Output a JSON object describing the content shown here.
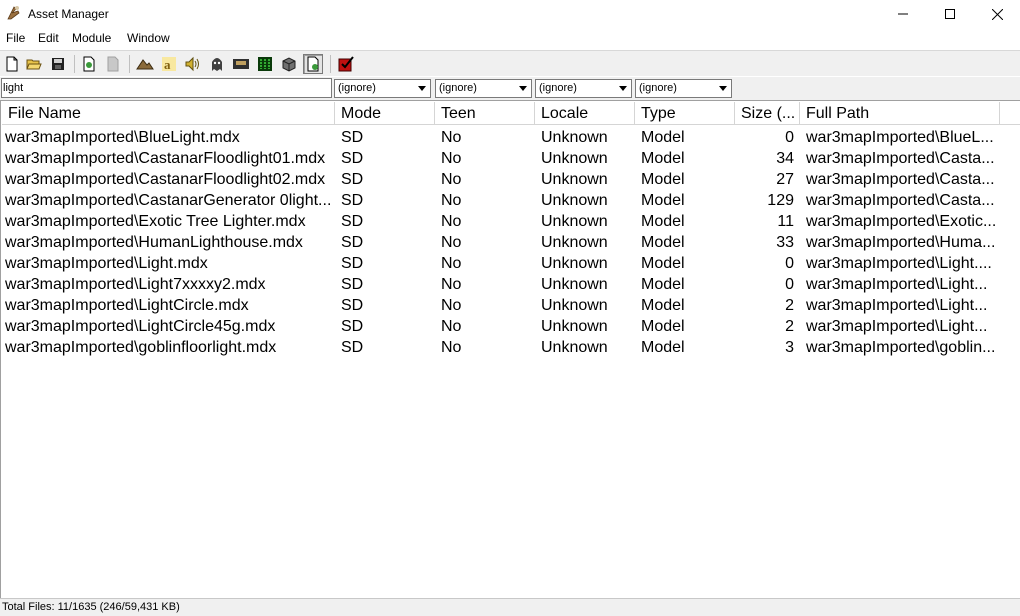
{
  "window": {
    "title": "Asset Manager"
  },
  "menu": [
    "File",
    "Edit",
    "Module",
    "Window"
  ],
  "toolbar": {
    "buttons": [
      {
        "name": "new-file-icon",
        "color": "#ffffff"
      },
      {
        "name": "open-folder-icon",
        "color": "#e8c34a"
      },
      {
        "name": "save-disk-icon",
        "color": "#202020"
      },
      {
        "name": "import-icon",
        "color": "#3a9a3a"
      },
      {
        "name": "export-disabled-icon",
        "color": "#b0b0b0"
      },
      {
        "name": "terrain-icon",
        "color": "#8a6a3a"
      },
      {
        "name": "font-icon",
        "color": "#c09010"
      },
      {
        "name": "sound-icon",
        "color": "#d0b030"
      },
      {
        "name": "ghost-icon",
        "color": "#404040"
      },
      {
        "name": "tape-icon",
        "color": "#303030"
      },
      {
        "name": "matrix-icon",
        "color": "#1a6a1a"
      },
      {
        "name": "cube-icon",
        "color": "#606060"
      },
      {
        "name": "page-add-icon",
        "color": "#3a9a3a"
      },
      {
        "name": "checkbox-red-icon",
        "color": "#c01010"
      }
    ]
  },
  "filters": {
    "search_value": "light",
    "combos": [
      "(ignore)",
      "(ignore)",
      "(ignore)",
      "(ignore)"
    ]
  },
  "columns": [
    "File Name",
    "Mode",
    "Teen",
    "Locale",
    "Type",
    "Size (...",
    "Full Path"
  ],
  "rows": [
    {
      "file": "war3mapImported\\BlueLight.mdx",
      "mode": "SD",
      "teen": "No",
      "locale": "Unknown",
      "type": "Model",
      "size": "0",
      "path": "war3mapImported\\BlueL..."
    },
    {
      "file": "war3mapImported\\CastanarFloodlight01.mdx",
      "mode": "SD",
      "teen": "No",
      "locale": "Unknown",
      "type": "Model",
      "size": "34",
      "path": "war3mapImported\\Casta..."
    },
    {
      "file": "war3mapImported\\CastanarFloodlight02.mdx",
      "mode": "SD",
      "teen": "No",
      "locale": "Unknown",
      "type": "Model",
      "size": "27",
      "path": "war3mapImported\\Casta..."
    },
    {
      "file": "war3mapImported\\CastanarGenerator 0light...",
      "mode": "SD",
      "teen": "No",
      "locale": "Unknown",
      "type": "Model",
      "size": "129",
      "path": "war3mapImported\\Casta..."
    },
    {
      "file": "war3mapImported\\Exotic Tree Lighter.mdx",
      "mode": "SD",
      "teen": "No",
      "locale": "Unknown",
      "type": "Model",
      "size": "11",
      "path": "war3mapImported\\Exotic..."
    },
    {
      "file": "war3mapImported\\HumanLighthouse.mdx",
      "mode": "SD",
      "teen": "No",
      "locale": "Unknown",
      "type": "Model",
      "size": "33",
      "path": "war3mapImported\\Huma..."
    },
    {
      "file": "war3mapImported\\Light.mdx",
      "mode": "SD",
      "teen": "No",
      "locale": "Unknown",
      "type": "Model",
      "size": "0",
      "path": "war3mapImported\\Light...."
    },
    {
      "file": "war3mapImported\\Light7xxxxy2.mdx",
      "mode": "SD",
      "teen": "No",
      "locale": "Unknown",
      "type": "Model",
      "size": "0",
      "path": "war3mapImported\\Light..."
    },
    {
      "file": "war3mapImported\\LightCircle.mdx",
      "mode": "SD",
      "teen": "No",
      "locale": "Unknown",
      "type": "Model",
      "size": "2",
      "path": "war3mapImported\\Light..."
    },
    {
      "file": "war3mapImported\\LightCircle45g.mdx",
      "mode": "SD",
      "teen": "No",
      "locale": "Unknown",
      "type": "Model",
      "size": "2",
      "path": "war3mapImported\\Light..."
    },
    {
      "file": "war3mapImported\\goblinfloorlight.mdx",
      "mode": "SD",
      "teen": "No",
      "locale": "Unknown",
      "type": "Model",
      "size": "3",
      "path": "war3mapImported\\goblin..."
    }
  ],
  "status": {
    "text": "Total Files: 11/1635 (246/59,431 KB)"
  }
}
